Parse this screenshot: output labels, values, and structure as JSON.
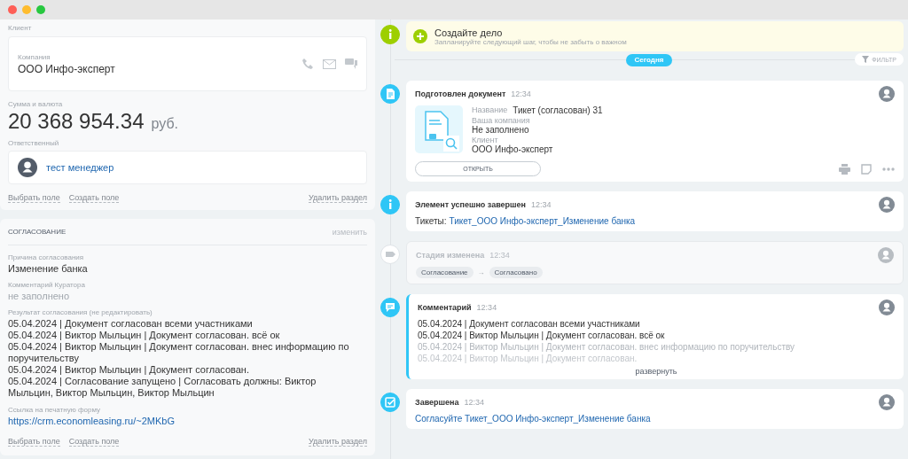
{
  "client_section": {
    "label": "Клиент",
    "company_label": "Компания",
    "company": "ООО Инфо-эксперт",
    "amount_label": "Сумма и валюта",
    "amount": "20 368 954.34",
    "currency": "руб.",
    "responsible_label": "Ответственный",
    "responsible": "тест менеджер",
    "links": [
      "Выбрать поле",
      "Создать поле"
    ],
    "delete_link": "Удалить раздел"
  },
  "approval_section": {
    "title": "СОГЛАСОВАНИЕ",
    "edit_link": "изменить",
    "fields": [
      {
        "label": "Причина согласования",
        "value": "Изменение банка",
        "empty": false,
        "kind": "text"
      },
      {
        "label": "Комментарий Куратора",
        "value": "не заполнено",
        "empty": true,
        "kind": "text"
      },
      {
        "label": "Результат согласования (не редактировать)",
        "lines": [
          "05.04.2024 | Документ согласован всеми участниками",
          "05.04.2024 | Виктор Мыльцин | Документ согласован. всё ок",
          "05.04.2024 | Виктор Мыльцин | Документ согласован. внес информацию по поручительству",
          "05.04.2024 | Виктор Мыльцин | Документ согласован.",
          "05.04.2024 | Согласование запущено | Согласовать должны: Виктор Мыльцин, Виктор Мыльцин, Виктор Мыльцин"
        ],
        "kind": "lines"
      },
      {
        "label": "Ссылка на печатную форму",
        "value": "https://crm.economleasing.ru/~2MKbG",
        "kind": "link"
      }
    ],
    "links": [
      "Выбрать поле",
      "Создать поле"
    ],
    "delete_link": "Удалить раздел"
  },
  "timeline": {
    "create": {
      "title": "Создайте дело",
      "hint": "Запланируйте следующий шаг, чтобы не забыть о важном"
    },
    "today": "Сегодня",
    "filter": "ФИЛЬТР",
    "items": [
      {
        "kind": "document",
        "title": "Подготовлен документ",
        "time": "12:34",
        "fields": [
          {
            "label": "Название",
            "value": "Тикет (согласован) 31",
            "inline": true
          },
          {
            "label": "Ваша компания",
            "value": "Не заполнено",
            "inline": false
          },
          {
            "label": "Клиент",
            "value": "ООО Инфо-эксперт",
            "inline": false
          }
        ],
        "button": "ОТКРЫТЬ"
      },
      {
        "kind": "info",
        "title": "Элемент успешно завершен",
        "time": "12:34",
        "prefix": "Тикеты:",
        "link": "Тикет_ООО Инфо-эксперт_Изменение банка"
      },
      {
        "kind": "stage",
        "title": "Стадия изменена",
        "time": "12:34",
        "from": "Согласование",
        "arrow": "→",
        "to": "Согласовано"
      },
      {
        "kind": "comment",
        "title": "Комментарий",
        "time": "12:34",
        "lines": [
          "05.04.2024 | Документ согласован всеми участниками",
          "05.04.2024 | Виктор Мыльцин | Документ согласован. всё ок",
          "05.04.2024 | Виктор Мыльцин | Документ согласован. внес информацию по поручительству",
          "05.04.2024 | Виктор Мыльцин | Документ согласован."
        ],
        "expand": "развернуть"
      },
      {
        "kind": "task",
        "title": "Завершена",
        "time": "12:34",
        "link": "Согласуйте Тикет_ООО Инфо-эксперт_Изменение банка"
      }
    ]
  }
}
